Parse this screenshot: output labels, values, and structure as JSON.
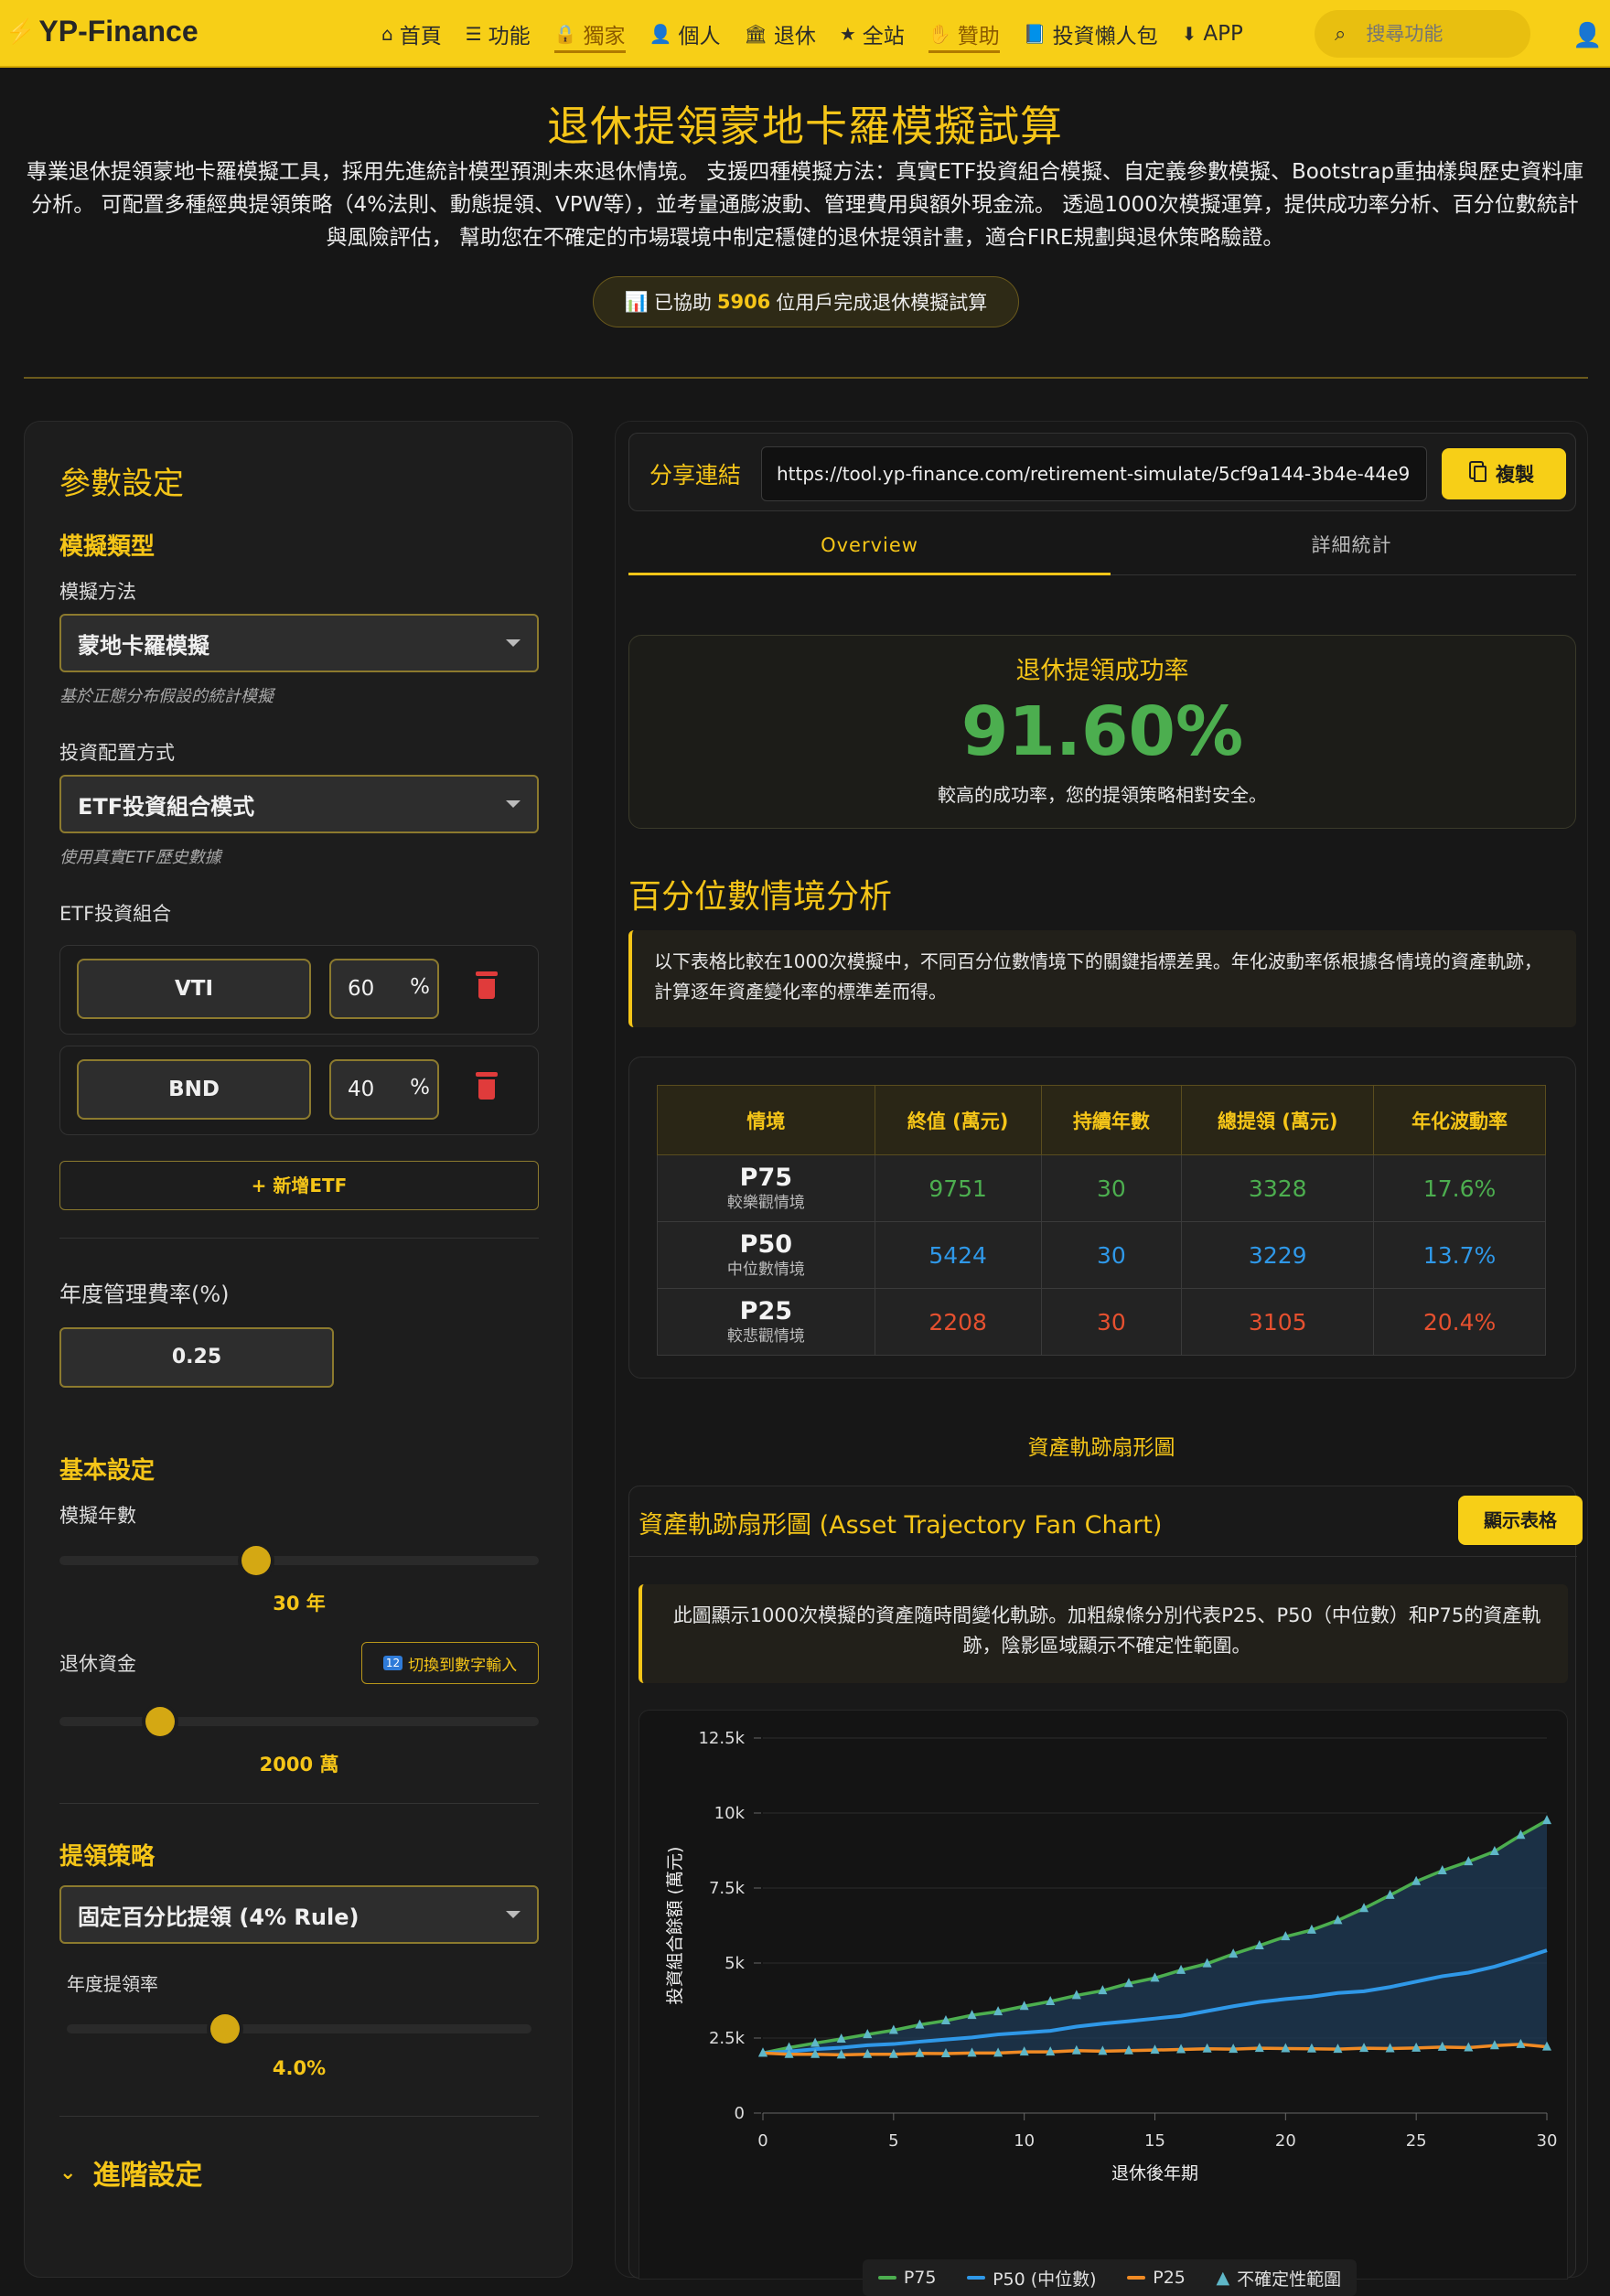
{
  "header": {
    "logo": "YP-Finance",
    "nav": [
      {
        "label": "首頁",
        "icon": "home-icon",
        "glyph": "⌂"
      },
      {
        "label": "功能",
        "icon": "list-icon",
        "glyph": "☰"
      },
      {
        "label": "獨家",
        "icon": "lock-icon",
        "glyph": "🔒"
      },
      {
        "label": "個人",
        "icon": "person-icon",
        "glyph": "👤"
      },
      {
        "label": "退休",
        "icon": "bank-icon",
        "glyph": "🏛"
      },
      {
        "label": "全站",
        "icon": "star-icon",
        "glyph": "★"
      },
      {
        "label": "贊助",
        "icon": "donate-icon",
        "glyph": "✋"
      },
      {
        "label": "投資懶人包",
        "icon": "book-icon",
        "glyph": "📘"
      },
      {
        "label": "APP",
        "icon": "download-icon",
        "glyph": "⬇"
      }
    ],
    "search_placeholder": "搜尋功能"
  },
  "hero": {
    "title": "退休提領蒙地卡羅模擬試算",
    "description": "專業退休提領蒙地卡羅模擬工具，採用先進統計模型預測未來退休情境。 支援四種模擬方法：真實ETF投資組合模擬、自定義參數模擬、Bootstrap重抽樣與歷史資料庫分析。 可配置多種經典提領策略（4%法則、動態提領、VPW等），並考量通膨波動、管理費用與額外現金流。 透過1000次模擬運算，提供成功率分析、百分位數統計與風險評估， 幫助您在不確定的市場環境中制定穩健的退休提領計畫，適合FIRE規劃與退休策略驗證。",
    "badge_prefix": "已協助",
    "badge_count": "5906",
    "badge_suffix": "位用戶完成退休模擬試算"
  },
  "params": {
    "title": "參數設定",
    "sim_type_heading": "模擬類型",
    "method_label": "模擬方法",
    "method_value": "蒙地卡羅模擬",
    "method_hint": "基於正態分布假設的統計模擬",
    "alloc_label": "投資配置方式",
    "alloc_value": "ETF投資組合模式",
    "alloc_hint": "使用真實ETF歷史數據",
    "etf_label": "ETF投資組合",
    "etfs": [
      {
        "ticker": "VTI",
        "pct": "60"
      },
      {
        "ticker": "BND",
        "pct": "40"
      }
    ],
    "pct_sign": "%",
    "add_etf": "+ 新增ETF",
    "fee_label": "年度管理費率(%)",
    "fee_value": "0.25",
    "basic_heading": "基本設定",
    "years_label": "模擬年數",
    "years_value": "30 年",
    "years_fraction": 0.41,
    "capital_label": "退休資金",
    "capital_toggle": "切換到數字輸入",
    "capital_value": "2000 萬",
    "capital_fraction": 0.21,
    "withdraw_heading": "提領策略",
    "strategy_value": "固定百分比提領 (4% Rule)",
    "rate_label": "年度提領率",
    "rate_value": "4.0%",
    "rate_fraction": 0.34,
    "advanced": "進階設定"
  },
  "share": {
    "label": "分享連結",
    "url": "https://tool.yp-finance.com/retirement-simulate/5cf9a144-3b4e-44e9",
    "copy": "複製"
  },
  "tabs": [
    "Overview",
    "詳細統計"
  ],
  "success": {
    "title": "退休提領成功率",
    "value": "91.60%",
    "desc": "較高的成功率，您的提領策略相對安全。"
  },
  "percentile": {
    "title": "百分位數情境分析",
    "note": "以下表格比較在1000次模擬中，不同百分位數情境下的關鍵指標差異。年化波動率係根據各情境的資產軌跡，計算逐年資產變化率的標準差而得。",
    "headers": [
      "情境",
      "終值 (萬元)",
      "持續年數",
      "總提領 (萬元)",
      "年化波動率"
    ],
    "rows": [
      {
        "name": "P75",
        "sub": "較樂觀情境",
        "final": "9751",
        "years": "30",
        "total": "3328",
        "vol": "17.6%"
      },
      {
        "name": "P50",
        "sub": "中位數情境",
        "final": "5424",
        "years": "30",
        "total": "3229",
        "vol": "13.7%"
      },
      {
        "name": "P25",
        "sub": "較悲觀情境",
        "final": "2208",
        "years": "30",
        "total": "3105",
        "vol": "20.4%"
      }
    ]
  },
  "fan": {
    "section_label": "資產軌跡扇形圖",
    "title": "資產軌跡扇形圖 (Asset Trajectory Fan Chart)",
    "show_table": "顯示表格",
    "note": "此圖顯示1000次模擬的資產隨時間變化軌跡。加粗線條分別代表P25、P50（中位數）和P75的資產軌跡，陰影區域顯示不確定性範圍。"
  },
  "chart_data": {
    "type": "line",
    "xlabel": "退休後年期",
    "ylabel": "投資組合餘額 (萬元)",
    "xlim": [
      0,
      30
    ],
    "ylim": [
      0,
      12500
    ],
    "xticks": [
      0,
      5,
      10,
      15,
      20,
      25,
      30
    ],
    "yticks": [
      0,
      2500,
      5000,
      7500,
      10000,
      12500
    ],
    "ytick_labels": [
      "0",
      "2.5k",
      "5k",
      "7.5k",
      "10k",
      "12.5k"
    ],
    "grid": true,
    "legend_position": "bottom",
    "x": [
      0,
      1,
      2,
      3,
      4,
      5,
      6,
      7,
      8,
      9,
      10,
      11,
      12,
      13,
      14,
      15,
      16,
      17,
      18,
      19,
      20,
      21,
      22,
      23,
      24,
      25,
      26,
      27,
      28,
      29,
      30
    ],
    "series": [
      {
        "name": "P75",
        "color": "#4cae4f",
        "values": [
          2000,
          2180,
          2330,
          2470,
          2620,
          2760,
          2940,
          3080,
          3260,
          3380,
          3560,
          3720,
          3920,
          4080,
          4320,
          4500,
          4760,
          4980,
          5300,
          5580,
          5880,
          6100,
          6420,
          6820,
          7260,
          7720,
          8080,
          8380,
          8720,
          9260,
          9751
        ]
      },
      {
        "name": "P50 (中位數)",
        "color": "#2f98e8",
        "values": [
          2000,
          2050,
          2130,
          2180,
          2260,
          2300,
          2380,
          2450,
          2520,
          2620,
          2680,
          2740,
          2880,
          2980,
          3060,
          3150,
          3240,
          3400,
          3560,
          3700,
          3800,
          3880,
          4000,
          4060,
          4200,
          4380,
          4560,
          4680,
          4880,
          5140,
          5424
        ]
      },
      {
        "name": "P25",
        "color": "#f08a24",
        "values": [
          2000,
          1960,
          1960,
          1940,
          1960,
          1960,
          1990,
          1980,
          2000,
          2000,
          2040,
          2040,
          2080,
          2060,
          2080,
          2100,
          2120,
          2140,
          2130,
          2160,
          2150,
          2140,
          2130,
          2160,
          2150,
          2170,
          2200,
          2180,
          2250,
          2290,
          2208
        ]
      }
    ],
    "band_name": "不確定性範圍"
  }
}
